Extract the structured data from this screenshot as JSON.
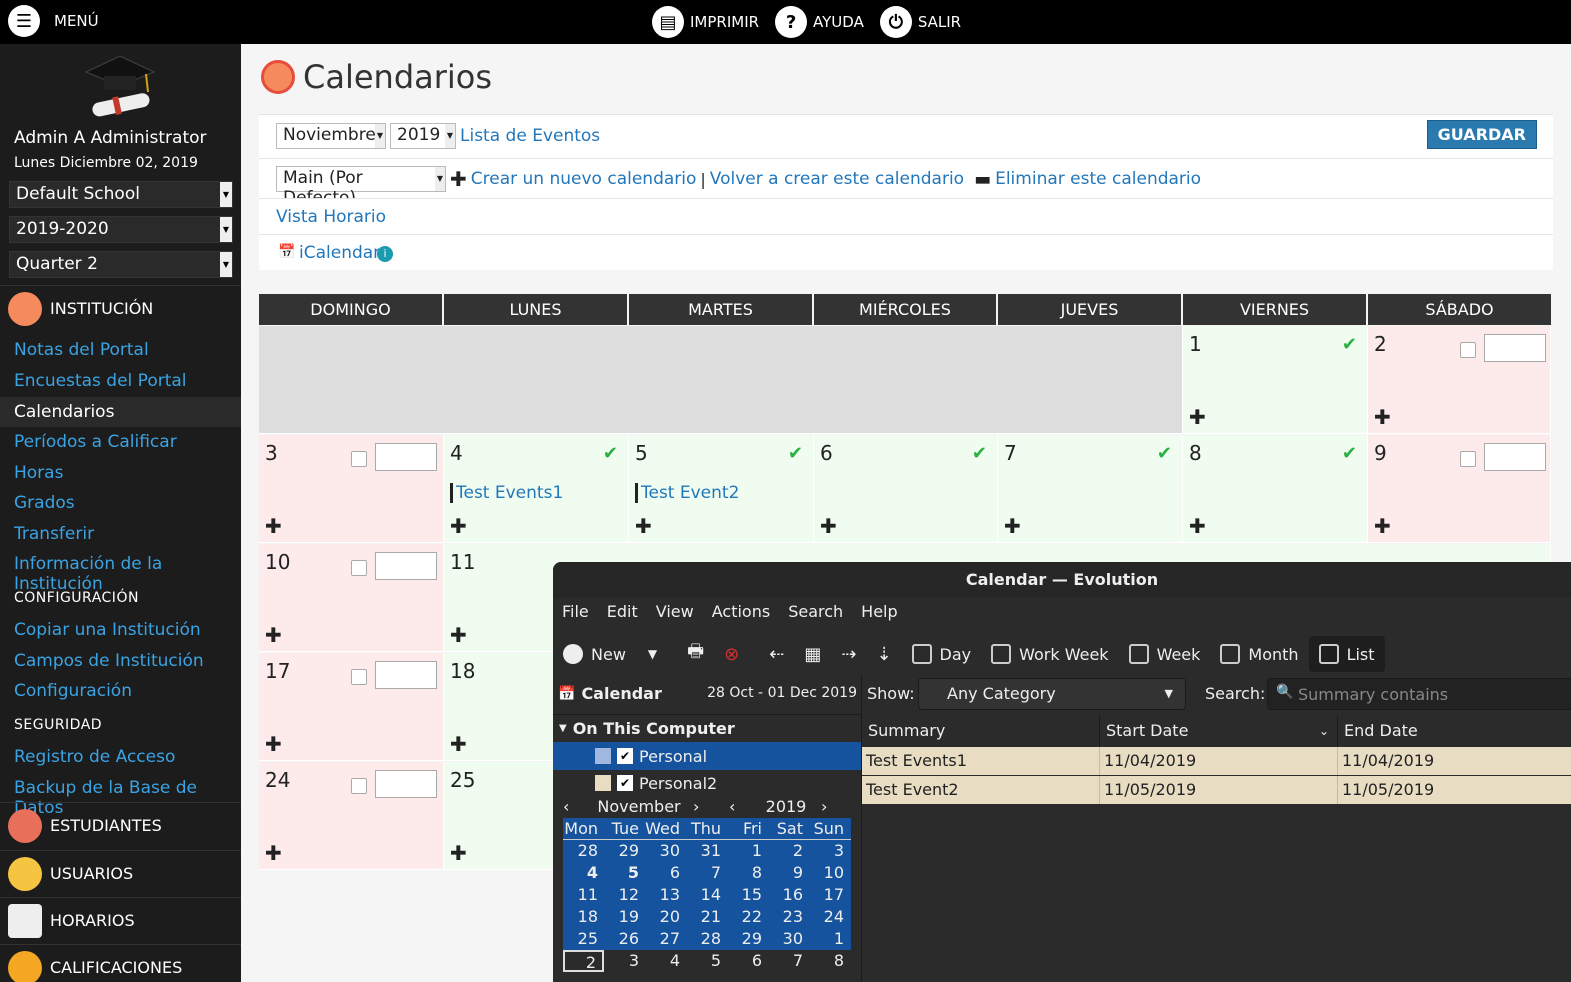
{
  "topbar": {
    "menu_label": "MENÚ",
    "print_label": "IMPRIMIR",
    "help_label": "AYUDA",
    "exit_label": "SALIR"
  },
  "sidebar": {
    "user_name": "Admin A Administrator",
    "user_date": "Lunes Diciembre 02, 2019",
    "school": "Default School",
    "year": "2019-2020",
    "quarter": "Quarter 2",
    "section_institucion": "INSTITUCIÓN",
    "links": [
      "Notas del Portal",
      "Encuestas del Portal",
      "Calendarios",
      "Períodos a Calificar",
      "Horas",
      "Grados",
      "Transferir",
      "Información de la Institución"
    ],
    "config_head": "CONFIGURACIÓN",
    "config_links": [
      "Copiar una Institución",
      "Campos de Institución",
      "Configuración"
    ],
    "security_head": "SEGURIDAD",
    "security_links": [
      "Registro de Acceso",
      "Backup de la Base de Datos"
    ],
    "sections": [
      "ESTUDIANTES",
      "USUARIOS",
      "HORARIOS",
      "CALIFICACIONES"
    ]
  },
  "main": {
    "title": "Calendarios",
    "month": "Noviembre",
    "year": "2019",
    "event_list_link": "Lista de Eventos",
    "save_button": "GUARDAR",
    "calendar_select": "Main (Por Defecto)",
    "create_link": "Crear un nuevo calendario",
    "separator": "|",
    "recreate_link": "Volver a crear este calendario",
    "delete_link": "Eliminar este calendario",
    "schedule_view": "Vista Horario",
    "icalendar": "iCalendar",
    "days": [
      "DOMINGO",
      "LUNES",
      "MARTES",
      "MIÉRCOLES",
      "JUEVES",
      "VIERNES",
      "SÁBADO"
    ],
    "events": {
      "day4": "Test Events1",
      "day5": "Test Event2"
    }
  },
  "evolution": {
    "window_title": "Calendar — Evolution",
    "menu": [
      "File",
      "Edit",
      "View",
      "Actions",
      "Search",
      "Help"
    ],
    "toolbar": {
      "new": "New",
      "views": [
        "Day",
        "Work Week",
        "Week",
        "Month",
        "List"
      ]
    },
    "calendar_label": "Calendar",
    "date_range": "28 Oct - 01 Dec 2019",
    "show_label": "Show:",
    "category": "Any Category",
    "search_label": "Search:",
    "search_placeholder": "Summary contains",
    "group": "On This Computer",
    "calendars": [
      "Personal",
      "Personal2"
    ],
    "mini_month": "November",
    "mini_year": "2019",
    "weekdays": [
      "Mon",
      "Tue",
      "Wed",
      "Thu",
      "Fri",
      "Sat",
      "Sun"
    ],
    "mini_weeks": [
      [
        "28",
        "29",
        "30",
        "31",
        "1",
        "2",
        "3"
      ],
      [
        "4",
        "5",
        "6",
        "7",
        "8",
        "9",
        "10"
      ],
      [
        "11",
        "12",
        "13",
        "14",
        "15",
        "16",
        "17"
      ],
      [
        "18",
        "19",
        "20",
        "21",
        "22",
        "23",
        "24"
      ],
      [
        "25",
        "26",
        "27",
        "28",
        "29",
        "30",
        "1"
      ],
      [
        "2",
        "3",
        "4",
        "5",
        "6",
        "7",
        "8"
      ]
    ],
    "columns": [
      "Summary",
      "Start Date",
      "End Date"
    ],
    "rows": [
      {
        "summary": "Test Events1",
        "start": "11/04/2019",
        "end": "11/04/2019"
      },
      {
        "summary": "Test Event2",
        "start": "11/05/2019",
        "end": "11/05/2019"
      }
    ]
  }
}
